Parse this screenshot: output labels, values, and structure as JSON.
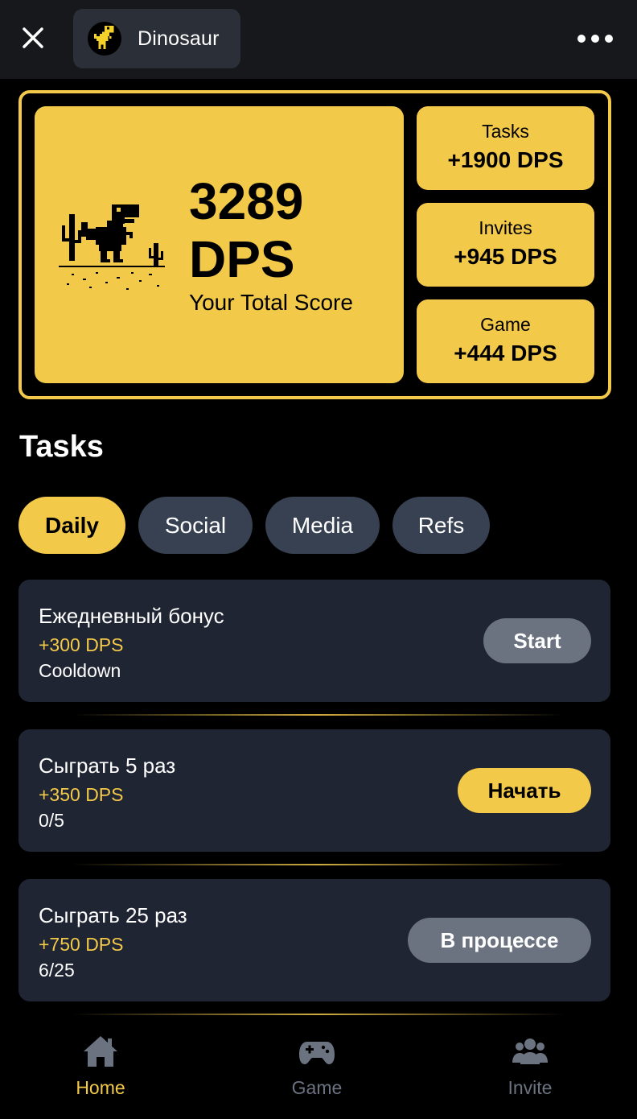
{
  "header": {
    "app_name": "Dinosaur",
    "close_icon": "close-icon",
    "more_icon": "more-horizontal-icon"
  },
  "score": {
    "value": "3289",
    "unit": "DPS",
    "caption": "Your Total Score",
    "stats": [
      {
        "label": "Tasks",
        "value": "+1900 DPS"
      },
      {
        "label": "Invites",
        "value": "+945 DPS"
      },
      {
        "label": "Game",
        "value": "+444 DPS"
      }
    ]
  },
  "tasks": {
    "title": "Tasks",
    "tabs": [
      {
        "label": "Daily",
        "active": true
      },
      {
        "label": "Social",
        "active": false
      },
      {
        "label": "Media",
        "active": false
      },
      {
        "label": "Refs",
        "active": false
      }
    ],
    "items": [
      {
        "title": "Ежедневный бонус",
        "reward": "+300 DPS",
        "status": "Cooldown",
        "button": "Start"
      },
      {
        "title": "Сыграть 5 раз",
        "reward": "+350 DPS",
        "status": "0/5",
        "button": "Начать"
      },
      {
        "title": "Сыграть 25 раз",
        "reward": "+750 DPS",
        "status": "6/25",
        "button": "В процессе"
      }
    ]
  },
  "nav": [
    {
      "label": "Home",
      "icon": "home-icon",
      "active": true
    },
    {
      "label": "Game",
      "icon": "gamepad-icon",
      "active": false
    },
    {
      "label": "Invite",
      "icon": "users-icon",
      "active": false
    }
  ],
  "colors": {
    "accent": "#f3c94a",
    "card": "#1f2533",
    "tab_inactive": "#374151",
    "button_grey": "#6b7280",
    "nav_inactive": "#6b7280"
  }
}
